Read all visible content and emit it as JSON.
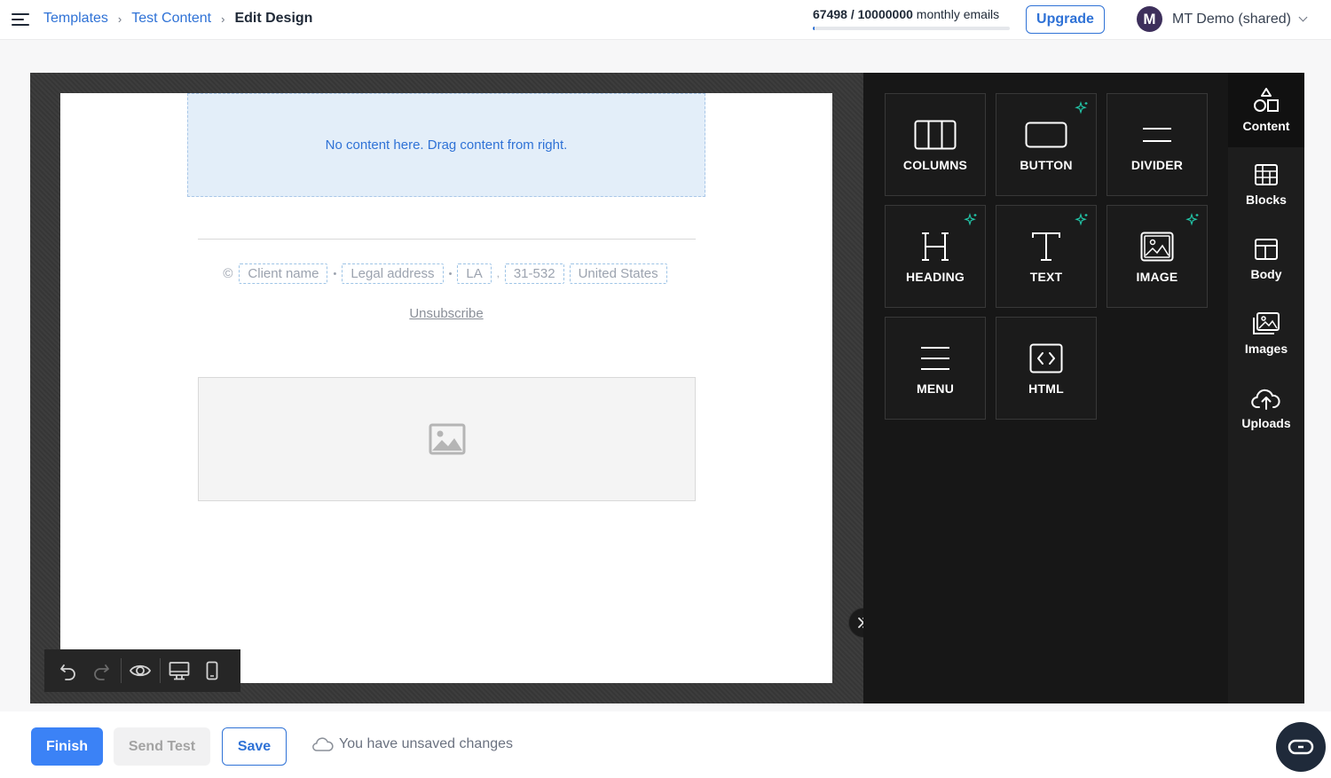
{
  "header": {
    "breadcrumbs": [
      "Templates",
      "Test Content",
      "Edit Design"
    ],
    "quota": {
      "used": "67498",
      "limit": "10000000",
      "suffix": "monthly emails",
      "fraction": 0.0067
    },
    "upgrade_label": "Upgrade",
    "account": {
      "initial": "M",
      "name": "MT Demo (shared)"
    }
  },
  "canvas": {
    "drop_zone_text": "No content here. Drag content from right.",
    "footer": {
      "copyright": "©",
      "fields": [
        "Client name",
        "Legal address",
        "LA",
        "31-532",
        "United States"
      ]
    },
    "unsubscribe": "Unsubscribe"
  },
  "tools": [
    {
      "label": "COLUMNS",
      "icon": "columns-icon",
      "ai": false
    },
    {
      "label": "BUTTON",
      "icon": "button-icon",
      "ai": true
    },
    {
      "label": "DIVIDER",
      "icon": "divider-icon",
      "ai": false
    },
    {
      "label": "HEADING",
      "icon": "heading-icon",
      "ai": true
    },
    {
      "label": "TEXT",
      "icon": "text-icon",
      "ai": true
    },
    {
      "label": "IMAGE",
      "icon": "image-icon",
      "ai": true
    },
    {
      "label": "MENU",
      "icon": "menu-icon",
      "ai": false
    },
    {
      "label": "HTML",
      "icon": "html-icon",
      "ai": false
    }
  ],
  "side_tabs": [
    {
      "label": "Content",
      "icon": "shapes-icon",
      "active": true
    },
    {
      "label": "Blocks",
      "icon": "blocks-icon",
      "active": false
    },
    {
      "label": "Body",
      "icon": "body-layout-icon",
      "active": false
    },
    {
      "label": "Images",
      "icon": "images-icon",
      "active": false
    },
    {
      "label": "Uploads",
      "icon": "cloud-upload-icon",
      "active": false
    }
  ],
  "bottom": {
    "finish_label": "Finish",
    "send_test_label": "Send Test",
    "save_label": "Save",
    "status": "You have unsaved changes"
  },
  "colors": {
    "accent": "#2f72d6",
    "primary_button": "#3b82f6",
    "panel_bg": "#171717",
    "ai_sparkle": "#22c3a6"
  }
}
